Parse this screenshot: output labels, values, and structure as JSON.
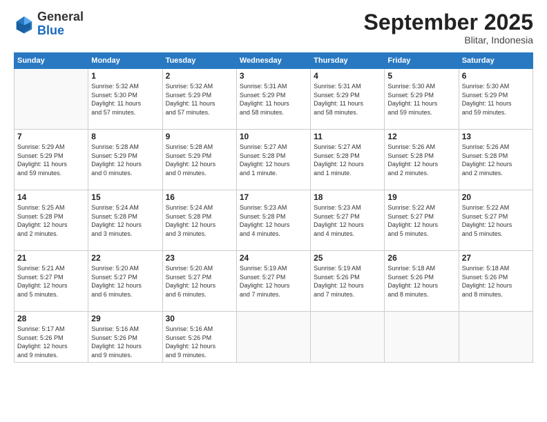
{
  "header": {
    "logo_general": "General",
    "logo_blue": "Blue",
    "title": "September 2025",
    "subtitle": "Blitar, Indonesia"
  },
  "days_of_week": [
    "Sunday",
    "Monday",
    "Tuesday",
    "Wednesday",
    "Thursday",
    "Friday",
    "Saturday"
  ],
  "weeks": [
    [
      {
        "day": "",
        "info": ""
      },
      {
        "day": "1",
        "info": "Sunrise: 5:32 AM\nSunset: 5:30 PM\nDaylight: 11 hours\nand 57 minutes."
      },
      {
        "day": "2",
        "info": "Sunrise: 5:32 AM\nSunset: 5:29 PM\nDaylight: 11 hours\nand 57 minutes."
      },
      {
        "day": "3",
        "info": "Sunrise: 5:31 AM\nSunset: 5:29 PM\nDaylight: 11 hours\nand 58 minutes."
      },
      {
        "day": "4",
        "info": "Sunrise: 5:31 AM\nSunset: 5:29 PM\nDaylight: 11 hours\nand 58 minutes."
      },
      {
        "day": "5",
        "info": "Sunrise: 5:30 AM\nSunset: 5:29 PM\nDaylight: 11 hours\nand 59 minutes."
      },
      {
        "day": "6",
        "info": "Sunrise: 5:30 AM\nSunset: 5:29 PM\nDaylight: 11 hours\nand 59 minutes."
      }
    ],
    [
      {
        "day": "7",
        "info": "Sunrise: 5:29 AM\nSunset: 5:29 PM\nDaylight: 11 hours\nand 59 minutes."
      },
      {
        "day": "8",
        "info": "Sunrise: 5:28 AM\nSunset: 5:29 PM\nDaylight: 12 hours\nand 0 minutes."
      },
      {
        "day": "9",
        "info": "Sunrise: 5:28 AM\nSunset: 5:29 PM\nDaylight: 12 hours\nand 0 minutes."
      },
      {
        "day": "10",
        "info": "Sunrise: 5:27 AM\nSunset: 5:28 PM\nDaylight: 12 hours\nand 1 minute."
      },
      {
        "day": "11",
        "info": "Sunrise: 5:27 AM\nSunset: 5:28 PM\nDaylight: 12 hours\nand 1 minute."
      },
      {
        "day": "12",
        "info": "Sunrise: 5:26 AM\nSunset: 5:28 PM\nDaylight: 12 hours\nand 2 minutes."
      },
      {
        "day": "13",
        "info": "Sunrise: 5:26 AM\nSunset: 5:28 PM\nDaylight: 12 hours\nand 2 minutes."
      }
    ],
    [
      {
        "day": "14",
        "info": "Sunrise: 5:25 AM\nSunset: 5:28 PM\nDaylight: 12 hours\nand 2 minutes."
      },
      {
        "day": "15",
        "info": "Sunrise: 5:24 AM\nSunset: 5:28 PM\nDaylight: 12 hours\nand 3 minutes."
      },
      {
        "day": "16",
        "info": "Sunrise: 5:24 AM\nSunset: 5:28 PM\nDaylight: 12 hours\nand 3 minutes."
      },
      {
        "day": "17",
        "info": "Sunrise: 5:23 AM\nSunset: 5:28 PM\nDaylight: 12 hours\nand 4 minutes."
      },
      {
        "day": "18",
        "info": "Sunrise: 5:23 AM\nSunset: 5:27 PM\nDaylight: 12 hours\nand 4 minutes."
      },
      {
        "day": "19",
        "info": "Sunrise: 5:22 AM\nSunset: 5:27 PM\nDaylight: 12 hours\nand 5 minutes."
      },
      {
        "day": "20",
        "info": "Sunrise: 5:22 AM\nSunset: 5:27 PM\nDaylight: 12 hours\nand 5 minutes."
      }
    ],
    [
      {
        "day": "21",
        "info": "Sunrise: 5:21 AM\nSunset: 5:27 PM\nDaylight: 12 hours\nand 5 minutes."
      },
      {
        "day": "22",
        "info": "Sunrise: 5:20 AM\nSunset: 5:27 PM\nDaylight: 12 hours\nand 6 minutes."
      },
      {
        "day": "23",
        "info": "Sunrise: 5:20 AM\nSunset: 5:27 PM\nDaylight: 12 hours\nand 6 minutes."
      },
      {
        "day": "24",
        "info": "Sunrise: 5:19 AM\nSunset: 5:27 PM\nDaylight: 12 hours\nand 7 minutes."
      },
      {
        "day": "25",
        "info": "Sunrise: 5:19 AM\nSunset: 5:26 PM\nDaylight: 12 hours\nand 7 minutes."
      },
      {
        "day": "26",
        "info": "Sunrise: 5:18 AM\nSunset: 5:26 PM\nDaylight: 12 hours\nand 8 minutes."
      },
      {
        "day": "27",
        "info": "Sunrise: 5:18 AM\nSunset: 5:26 PM\nDaylight: 12 hours\nand 8 minutes."
      }
    ],
    [
      {
        "day": "28",
        "info": "Sunrise: 5:17 AM\nSunset: 5:26 PM\nDaylight: 12 hours\nand 9 minutes."
      },
      {
        "day": "29",
        "info": "Sunrise: 5:16 AM\nSunset: 5:26 PM\nDaylight: 12 hours\nand 9 minutes."
      },
      {
        "day": "30",
        "info": "Sunrise: 5:16 AM\nSunset: 5:26 PM\nDaylight: 12 hours\nand 9 minutes."
      },
      {
        "day": "",
        "info": ""
      },
      {
        "day": "",
        "info": ""
      },
      {
        "day": "",
        "info": ""
      },
      {
        "day": "",
        "info": ""
      }
    ]
  ]
}
